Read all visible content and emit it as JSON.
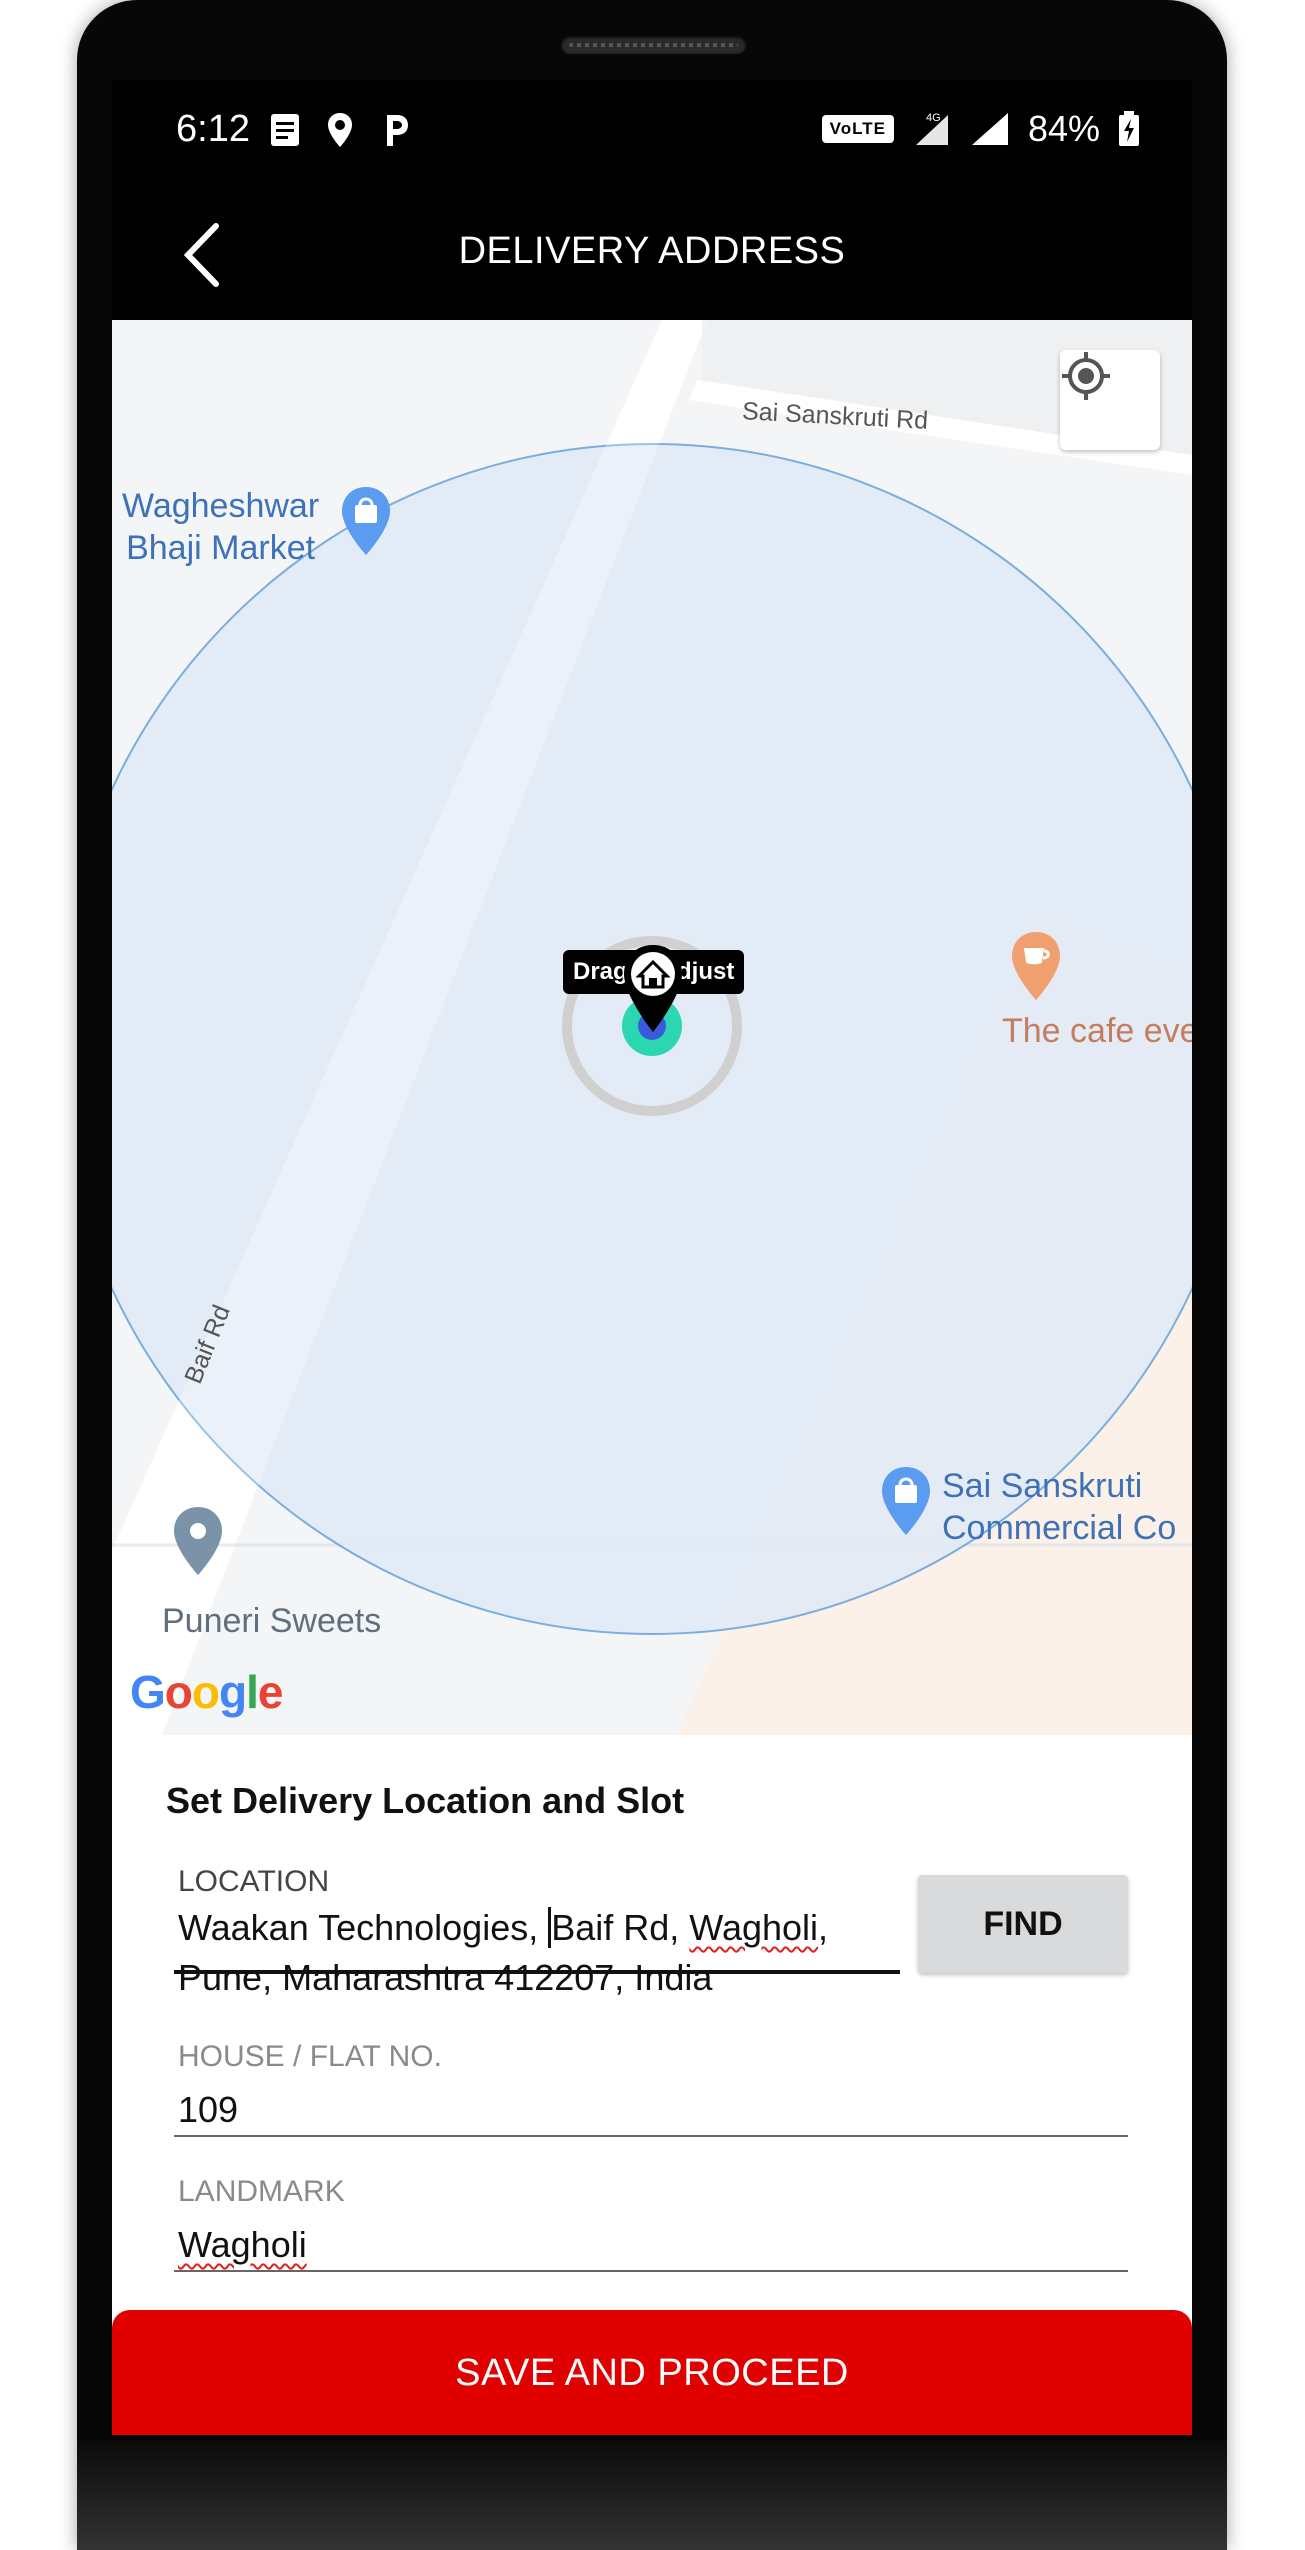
{
  "status_bar": {
    "time": "6:12",
    "volte": "VoLTE",
    "network": "4G",
    "battery": "84%"
  },
  "header": {
    "title": "DELIVERY ADDRESS"
  },
  "map": {
    "road_labels": {
      "sai_sanskruti_rd": "Sai Sanskruti Rd",
      "baif_rd": "Baif Rd"
    },
    "pois": {
      "wagheshwar": [
        "Wagheshwar",
        "Bhaji Market"
      ],
      "cafe": "The cafe eve",
      "sai_sanskruti_commercial": [
        "Sai Sanskruti",
        "Commercial Co"
      ],
      "puneri_sweets": "Puneri Sweets"
    },
    "tooltip": "Drag to adjust",
    "attribution": "Google",
    "colors": {
      "circle_fill": "#dfeaf6",
      "circle_stroke": "#7aaede",
      "poi_blue": "#3e72b8",
      "poi_orange": "#c57d5f",
      "marker_accent": "#2ad7b0"
    }
  },
  "form": {
    "title": "Set Delivery Location and Slot",
    "location": {
      "label": "LOCATION",
      "line1_a": "Waakan Technologies, ",
      "line1_b": "Baif Rd, ",
      "line1_c": "Wagholi",
      "line1_d": ",",
      "line2": "Pune, Maharashtra 412207, India"
    },
    "find_label": "FIND",
    "house": {
      "label": "HOUSE / FLAT NO.",
      "value": "109"
    },
    "landmark": {
      "label": "LANDMARK",
      "value": "Wagholi"
    }
  },
  "save_button": {
    "label": "SAVE AND PROCEED",
    "color": "#e10000"
  }
}
